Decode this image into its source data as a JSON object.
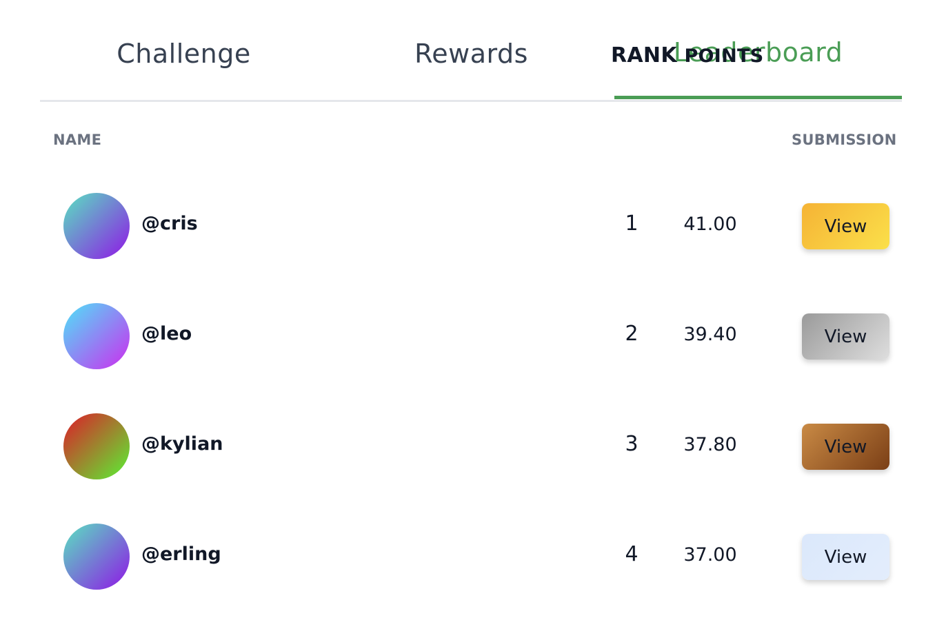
{
  "tabs": [
    {
      "label": "Challenge",
      "active": false
    },
    {
      "label": "Rewards",
      "active": false
    },
    {
      "label": "Leaderboard",
      "active": true
    }
  ],
  "columns": {
    "name": "NAME",
    "rank": "RANK",
    "points": "POINTS",
    "submission": "SUBMISSION"
  },
  "colors": {
    "accent": "#4a9d55",
    "header_text": "#6b7280"
  },
  "rows": [
    {
      "username": "@cris",
      "rank": "1",
      "points": "41.00",
      "button_label": "View",
      "avatar_gradient": [
        "#5ecfc4",
        "#8a2be2"
      ],
      "button_gradient": [
        "#f5b335",
        "#fbe04a"
      ]
    },
    {
      "username": "@leo",
      "rank": "2",
      "points": "39.40",
      "button_label": "View",
      "avatar_gradient": [
        "#5ad2f7",
        "#c03ff0"
      ],
      "button_gradient": [
        "#9a9a9a",
        "#dedede"
      ]
    },
    {
      "username": "@kylian",
      "rank": "3",
      "points": "37.80",
      "button_label": "View",
      "avatar_gradient": [
        "#d1302a",
        "#66dd33"
      ],
      "button_gradient": [
        "#c98a45",
        "#7b3f16"
      ]
    },
    {
      "username": "@erling",
      "rank": "4",
      "points": "37.00",
      "button_label": "View",
      "avatar_gradient": [
        "#5ecfc4",
        "#8a2be2"
      ],
      "button_gradient": [
        "#dbe8fb",
        "#e3edfc"
      ]
    }
  ]
}
